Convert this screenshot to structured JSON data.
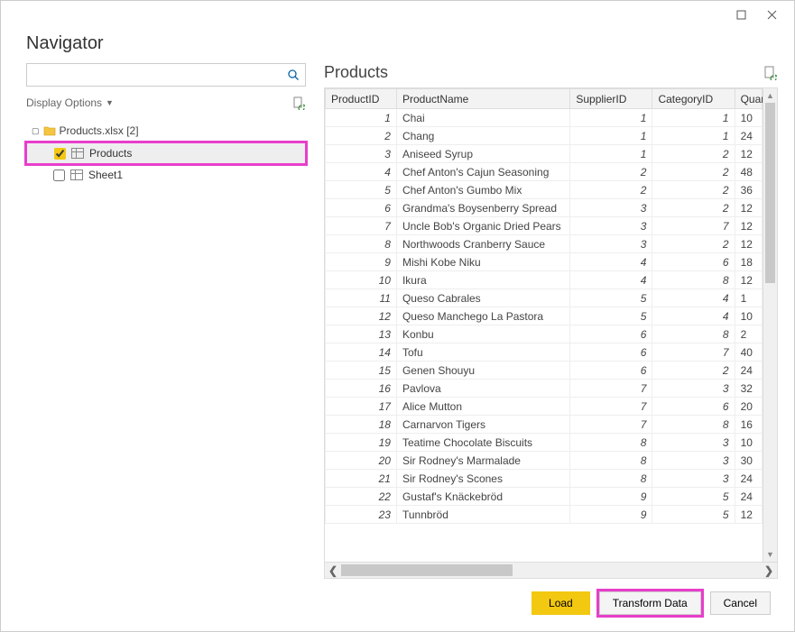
{
  "window": {
    "title": "Navigator"
  },
  "left": {
    "display_options": "Display Options",
    "search_placeholder": "",
    "root": {
      "label": "Products.xlsx [2]"
    },
    "items": [
      {
        "label": "Products",
        "checked": true,
        "selected": true
      },
      {
        "label": "Sheet1",
        "checked": false,
        "selected": false
      }
    ]
  },
  "preview": {
    "title": "Products",
    "columns": [
      "ProductID",
      "ProductName",
      "SupplierID",
      "CategoryID",
      "Quan"
    ],
    "rows": [
      {
        "pid": "1",
        "name": "Chai",
        "sid": "1",
        "cid": "1",
        "q": "10"
      },
      {
        "pid": "2",
        "name": "Chang",
        "sid": "1",
        "cid": "1",
        "q": "24"
      },
      {
        "pid": "3",
        "name": "Aniseed Syrup",
        "sid": "1",
        "cid": "2",
        "q": "12"
      },
      {
        "pid": "4",
        "name": "Chef Anton's Cajun Seasoning",
        "sid": "2",
        "cid": "2",
        "q": "48"
      },
      {
        "pid": "5",
        "name": "Chef Anton's Gumbo Mix",
        "sid": "2",
        "cid": "2",
        "q": "36"
      },
      {
        "pid": "6",
        "name": "Grandma's Boysenberry Spread",
        "sid": "3",
        "cid": "2",
        "q": "12"
      },
      {
        "pid": "7",
        "name": "Uncle Bob's Organic Dried Pears",
        "sid": "3",
        "cid": "7",
        "q": "12"
      },
      {
        "pid": "8",
        "name": "Northwoods Cranberry Sauce",
        "sid": "3",
        "cid": "2",
        "q": "12"
      },
      {
        "pid": "9",
        "name": "Mishi Kobe Niku",
        "sid": "4",
        "cid": "6",
        "q": "18"
      },
      {
        "pid": "10",
        "name": "Ikura",
        "sid": "4",
        "cid": "8",
        "q": "12"
      },
      {
        "pid": "11",
        "name": "Queso Cabrales",
        "sid": "5",
        "cid": "4",
        "q": "1"
      },
      {
        "pid": "12",
        "name": "Queso Manchego La Pastora",
        "sid": "5",
        "cid": "4",
        "q": "10"
      },
      {
        "pid": "13",
        "name": "Konbu",
        "sid": "6",
        "cid": "8",
        "q": "2"
      },
      {
        "pid": "14",
        "name": "Tofu",
        "sid": "6",
        "cid": "7",
        "q": "40"
      },
      {
        "pid": "15",
        "name": "Genen Shouyu",
        "sid": "6",
        "cid": "2",
        "q": "24"
      },
      {
        "pid": "16",
        "name": "Pavlova",
        "sid": "7",
        "cid": "3",
        "q": "32"
      },
      {
        "pid": "17",
        "name": "Alice Mutton",
        "sid": "7",
        "cid": "6",
        "q": "20"
      },
      {
        "pid": "18",
        "name": "Carnarvon Tigers",
        "sid": "7",
        "cid": "8",
        "q": "16"
      },
      {
        "pid": "19",
        "name": "Teatime Chocolate Biscuits",
        "sid": "8",
        "cid": "3",
        "q": "10"
      },
      {
        "pid": "20",
        "name": "Sir Rodney's Marmalade",
        "sid": "8",
        "cid": "3",
        "q": "30"
      },
      {
        "pid": "21",
        "name": "Sir Rodney's Scones",
        "sid": "8",
        "cid": "3",
        "q": "24"
      },
      {
        "pid": "22",
        "name": "Gustaf's Knäckebröd",
        "sid": "9",
        "cid": "5",
        "q": "24"
      },
      {
        "pid": "23",
        "name": "Tunnbröd",
        "sid": "9",
        "cid": "5",
        "q": "12"
      }
    ]
  },
  "footer": {
    "load": "Load",
    "transform": "Transform Data",
    "cancel": "Cancel"
  }
}
